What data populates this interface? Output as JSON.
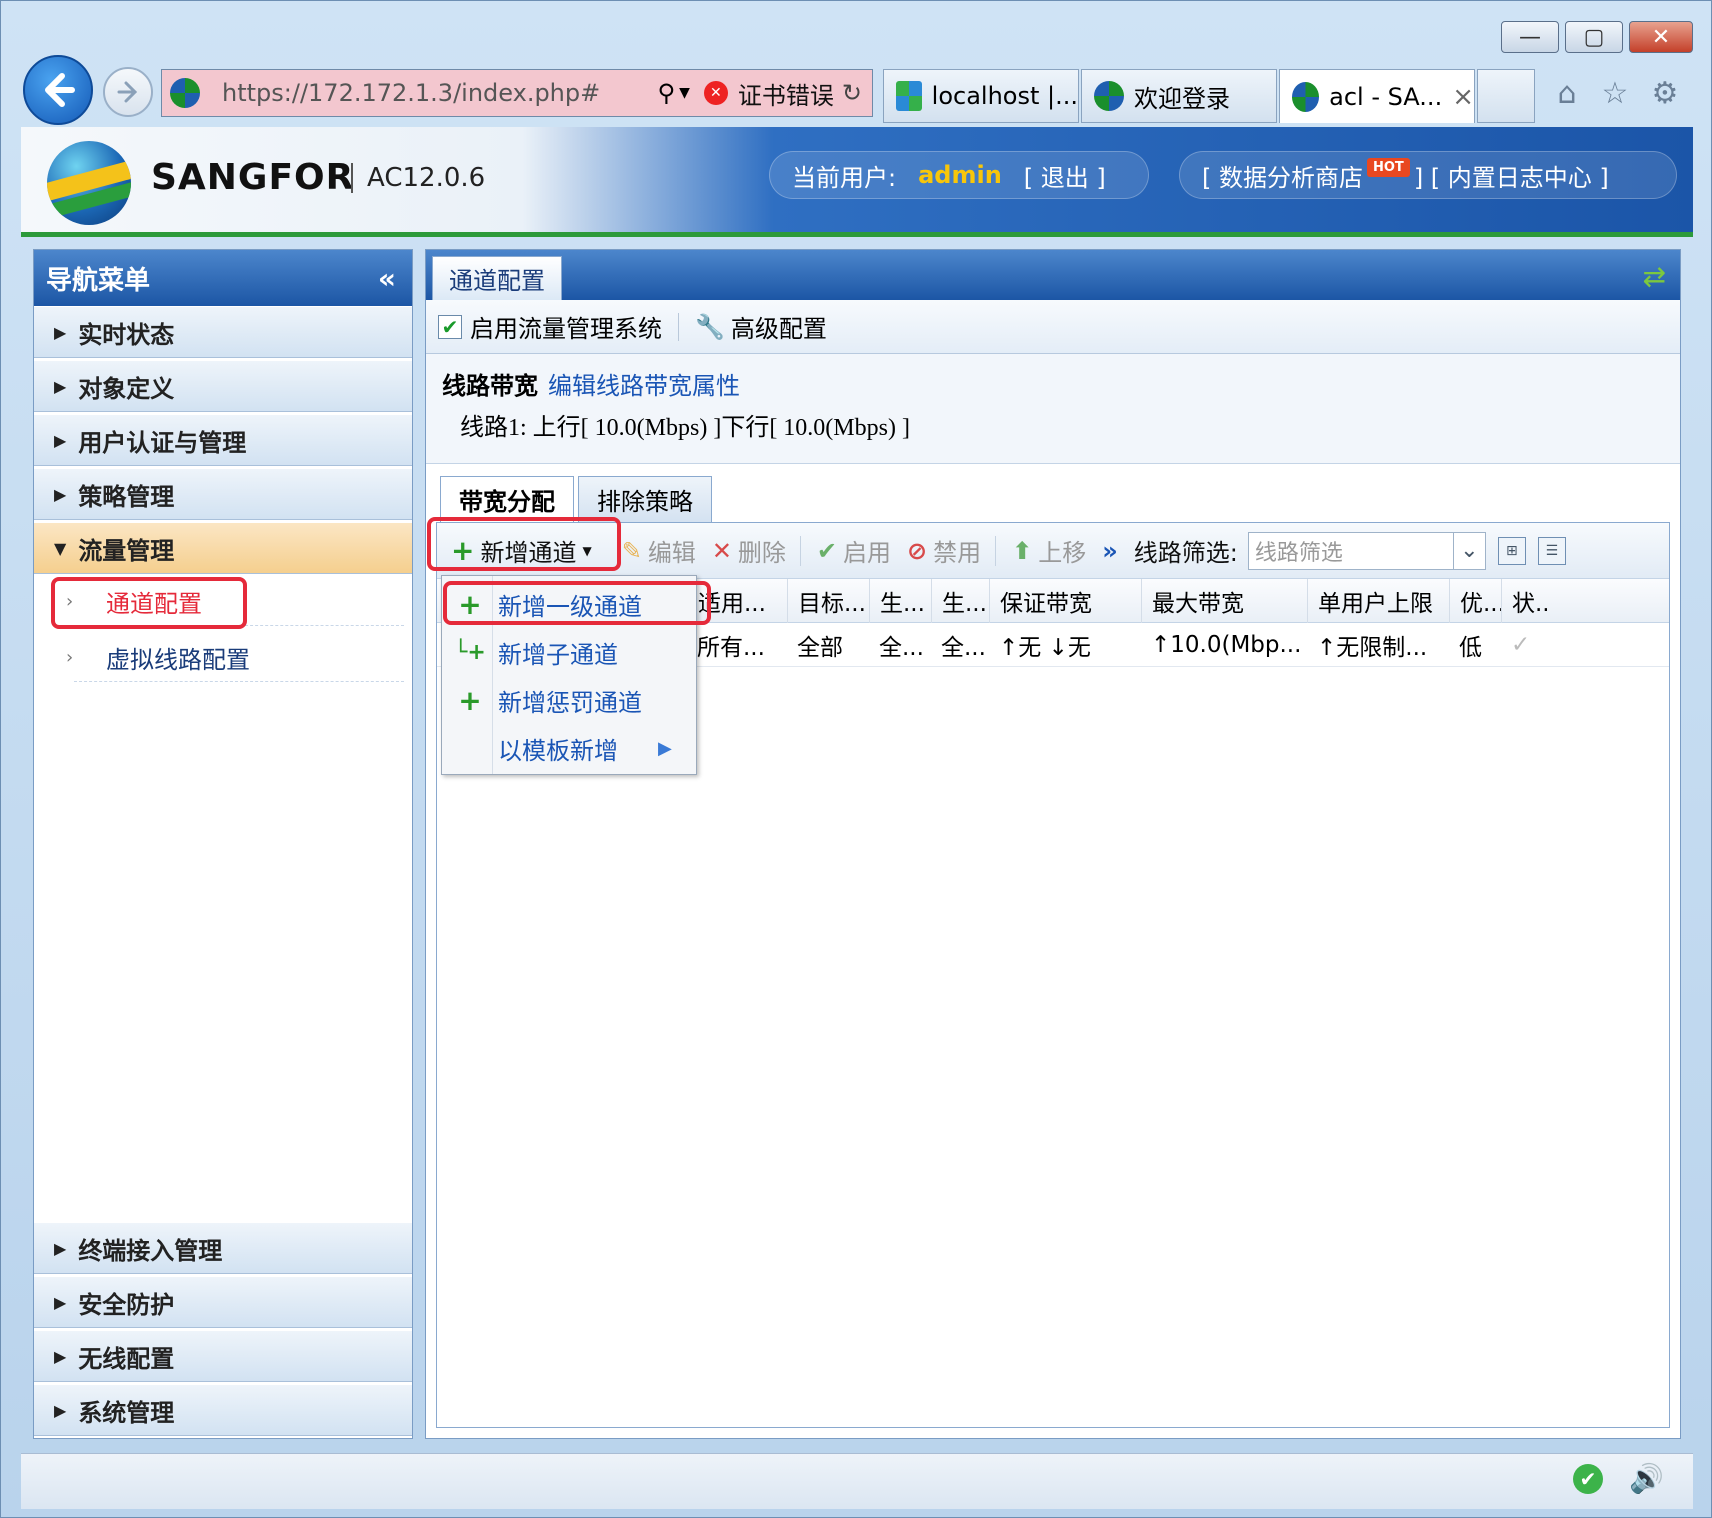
{
  "window": {
    "buttons": [
      "—",
      "▢",
      "✕"
    ]
  },
  "browser": {
    "url": "https://172.172.1.3/index.php#",
    "cert_error": "证书错误",
    "tabs": [
      {
        "label": "localhost |..."
      },
      {
        "label": "欢迎登录"
      },
      {
        "label": "acl - SA...",
        "close": "×"
      }
    ]
  },
  "header": {
    "brand": "SANGFOR",
    "version": "AC12.0.6",
    "user_prefix": "当前用户:",
    "username": "admin",
    "logout": "[ 退出 ]",
    "shop_prefix": "[ 数据分析商店",
    "hot": "HOT",
    "log_center": "] [ 内置日志中心 ]"
  },
  "sidebar": {
    "title": "导航菜单",
    "collapse": "«",
    "menu": [
      {
        "label": "实时状态"
      },
      {
        "label": "对象定义"
      },
      {
        "label": "用户认证与管理"
      },
      {
        "label": "策略管理"
      },
      {
        "label": "流量管理"
      }
    ],
    "sub_items": [
      {
        "label": "通道配置"
      },
      {
        "label": "虚拟线路配置"
      }
    ],
    "bottom_menu": [
      {
        "label": "终端接入管理"
      },
      {
        "label": "安全防护"
      },
      {
        "label": "无线配置"
      },
      {
        "label": "系统管理"
      }
    ]
  },
  "main": {
    "tab": "通道配置",
    "enable_label": "启用流量管理系统",
    "advanced": "高级配置",
    "bw_title": "线路带宽",
    "bw_edit": "编辑线路带宽属性",
    "bw_line": "线路1:  上行[ 10.0(Mbps) ]下行[ 10.0(Mbps) ]",
    "subtabs": [
      "带宽分配",
      "排除策略"
    ],
    "toolbar": {
      "add": "新增通道",
      "edit": "编辑",
      "delete": "删除",
      "enable": "启用",
      "disable": "禁用",
      "move_up": "上移",
      "more": "»",
      "filter_label": "线路筛选:",
      "filter_placeholder": "线路筛选"
    },
    "columns": [
      "适用...",
      "目标...",
      "生...",
      "生...",
      "保证带宽",
      "最大带宽",
      "单用户上限",
      "优...",
      "状..."
    ],
    "rows": [
      [
        "所有...",
        "全部",
        "全...",
        "全...",
        "↑无 ↓无",
        "↑10.0(Mbp...",
        "↑无限制...",
        "低",
        "✓"
      ]
    ]
  },
  "dropdown": {
    "items": [
      {
        "label": "新增一级通道"
      },
      {
        "label": "新增子通道"
      },
      {
        "label": "新增惩罚通道"
      },
      {
        "label": "以模板新增",
        "arrow": "▶"
      }
    ]
  },
  "colors": {
    "accent": "#1c56a5",
    "highlight": "#e52a3a",
    "admin": "#f8c60a",
    "green": "#2c9a3a"
  }
}
